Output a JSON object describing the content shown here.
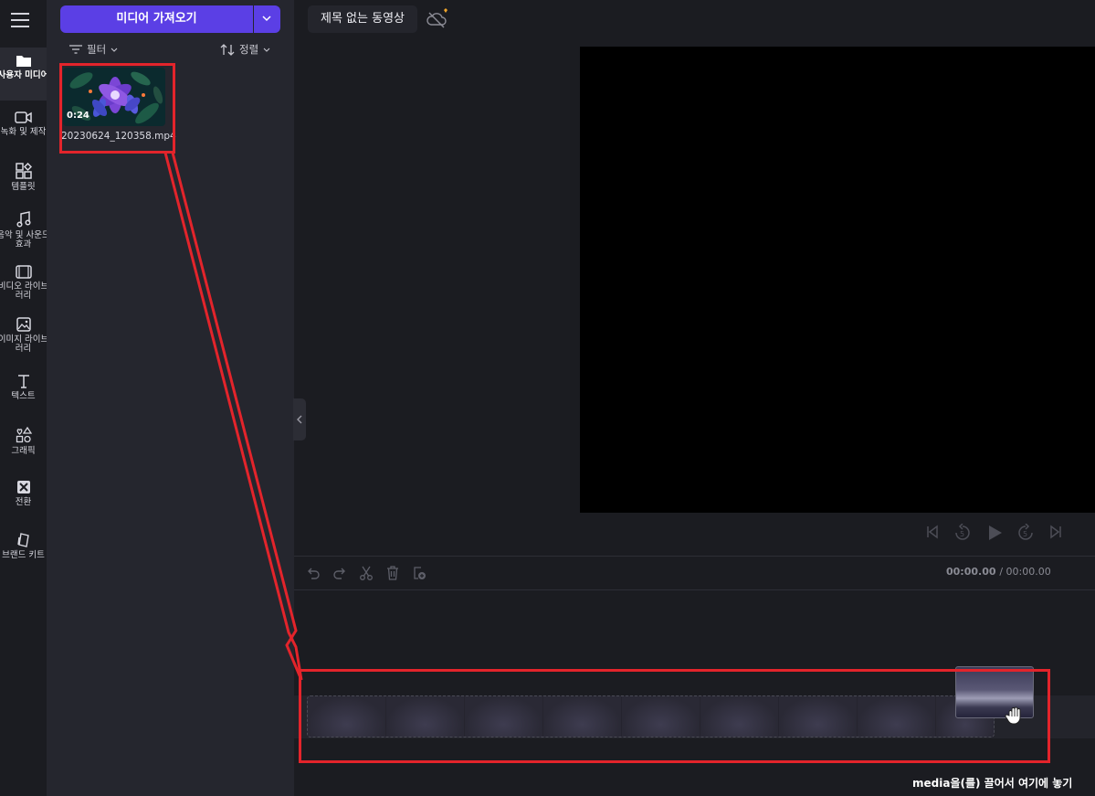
{
  "rail": {
    "items": [
      {
        "label": "사용자 미디어",
        "icon": "folder-icon",
        "active": true
      },
      {
        "label": "녹화 및 제작",
        "icon": "video-camera-icon"
      },
      {
        "label": "템플릿",
        "icon": "templates-icon"
      },
      {
        "label": "음악 및 사운드 효과",
        "icon": "music-note-icon"
      },
      {
        "label": "비디오 라이브러리",
        "icon": "film-icon"
      },
      {
        "label": "이미지 라이브러리",
        "icon": "image-icon"
      },
      {
        "label": "텍스트",
        "icon": "text-icon"
      },
      {
        "label": "그래픽",
        "icon": "shapes-icon"
      },
      {
        "label": "전환",
        "icon": "transition-icon"
      },
      {
        "label": "브랜드 키트",
        "icon": "brand-kit-icon"
      }
    ]
  },
  "panel": {
    "import_label": "미디어 가져오기",
    "filter_label": "필터",
    "sort_label": "정렬",
    "media": {
      "duration": "0:24",
      "filename": "20230624_120358.mp4"
    }
  },
  "header": {
    "project_title": "제목 없는 동영상"
  },
  "timeline": {
    "current_time": "00:00.00",
    "total_time": "/ 00:00.00",
    "drop_hint": "media을(를) 끌어서 여기에 놓기"
  },
  "colors": {
    "accent": "#5b3fe5",
    "annotation_red": "#e3242b",
    "background": "#1b1c21",
    "panel": "#25262e"
  }
}
